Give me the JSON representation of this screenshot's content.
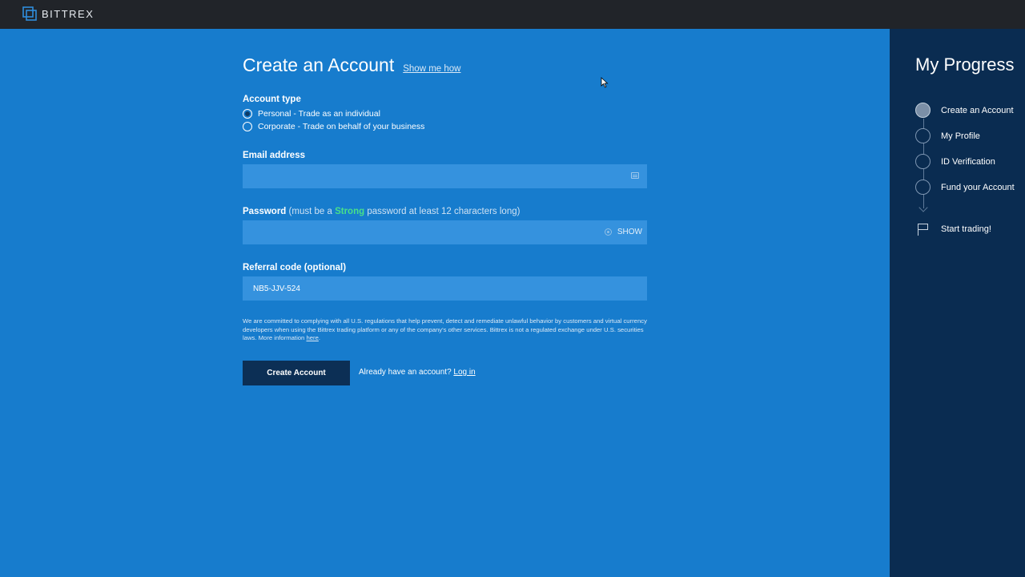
{
  "brand": {
    "name": "BITTREX",
    "logo_icon": "bittrex-logo-icon"
  },
  "form": {
    "title": "Create an Account",
    "show_me_how": "Show me how",
    "account_type": {
      "label": "Account type",
      "options": [
        {
          "label": "Personal - Trade as an individual",
          "selected": true
        },
        {
          "label": "Corporate - Trade on behalf of your business",
          "selected": false
        }
      ]
    },
    "email": {
      "label": "Email address",
      "value": "",
      "icon": "card-icon"
    },
    "password": {
      "label": "Password",
      "note_prefix": "(must be a",
      "strong_word": "Strong",
      "note_suffix": "password at least 12 characters long)",
      "value": "",
      "show_label": "SHOW"
    },
    "referral": {
      "label": "Referral code (optional)",
      "value": "NB5-JJV-524"
    },
    "disclaimer": {
      "text": "We are committed to complying with all U.S. regulations that help prevent, detect and remediate unlawful behavior by customers and virtual currency developers when using the Bittrex trading platform or any of the company's other services. Bittrex is not a regulated exchange under U.S. securities laws. More information",
      "link": "here",
      "end": "."
    },
    "submit_label": "Create Account",
    "login_prompt": "Already have an account?",
    "login_link": "Log in"
  },
  "sidebar": {
    "title": "My Progress",
    "steps": [
      {
        "label": "Create an Account",
        "active": true
      },
      {
        "label": "My Profile",
        "active": false
      },
      {
        "label": "ID Verification",
        "active": false
      },
      {
        "label": "Fund your Account",
        "active": false
      }
    ],
    "final_step": {
      "label": "Start trading!",
      "icon": "flag-icon"
    }
  },
  "colors": {
    "topbar": "#212429",
    "main_bg": "#177ccd",
    "field_bg": "#3592de",
    "button_bg": "#0c2f55",
    "sidebar_bg": "#0a2c51",
    "strong_green": "#48e08a"
  }
}
